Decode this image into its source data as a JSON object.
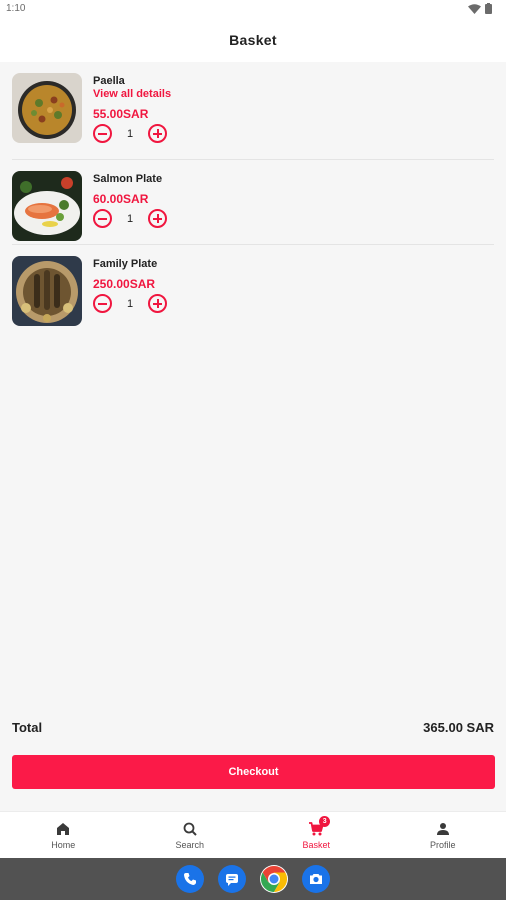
{
  "status": {
    "time": "1:10"
  },
  "header": {
    "title": "Basket"
  },
  "items": [
    {
      "name": "Paella",
      "details_link": "View all details",
      "price": "55.00SAR",
      "quantity": "1",
      "image": "paella-dish"
    },
    {
      "name": "Salmon Plate",
      "price": "60.00SAR",
      "quantity": "1",
      "image": "salmon-plate"
    },
    {
      "name": "Family Plate",
      "price": "250.00SAR",
      "quantity": "1",
      "image": "family-plate"
    }
  ],
  "total": {
    "label": "Total",
    "value": "365.00 SAR"
  },
  "checkout": {
    "label": "Checkout"
  },
  "nav": {
    "items": [
      {
        "label": "Home",
        "icon": "home-icon"
      },
      {
        "label": "Search",
        "icon": "search-icon"
      },
      {
        "label": "Basket",
        "icon": "cart-icon",
        "badge": "3",
        "active": true
      },
      {
        "label": "Profile",
        "icon": "person-icon"
      }
    ]
  },
  "dock": {
    "apps": [
      "phone-icon",
      "messages-icon",
      "chrome-icon",
      "camera-icon"
    ]
  },
  "colors": {
    "accent": "#f0163f",
    "checkout": "#fb1a48",
    "background": "#f6f6f6",
    "system_bar": "#525252"
  }
}
